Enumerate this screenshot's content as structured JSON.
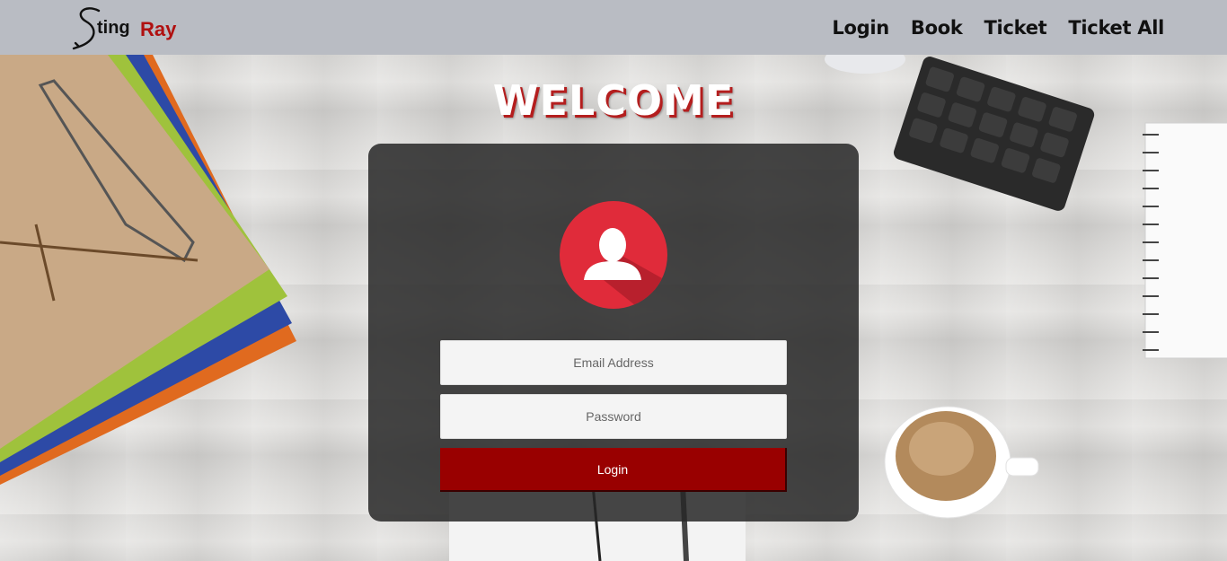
{
  "brand": {
    "initial": "S",
    "name_part1": "ting",
    "name_part2": "Ray"
  },
  "nav": {
    "items": [
      {
        "label": "Login"
      },
      {
        "label": "Book"
      },
      {
        "label": "Ticket"
      },
      {
        "label": "Ticket All"
      }
    ]
  },
  "main": {
    "heading": "WELCOME",
    "login_form": {
      "email_placeholder": "Email Address",
      "password_placeholder": "Password",
      "submit_label": "Login"
    }
  },
  "colors": {
    "navbar_bg": "#b9bcc3",
    "brand_accent": "#b01010",
    "button_bg": "#990000",
    "avatar_circle": "#e02b3a",
    "card_bg": "rgba(40,40,40,0.86)"
  },
  "icons": {
    "avatar": "user-silhouette-icon"
  }
}
